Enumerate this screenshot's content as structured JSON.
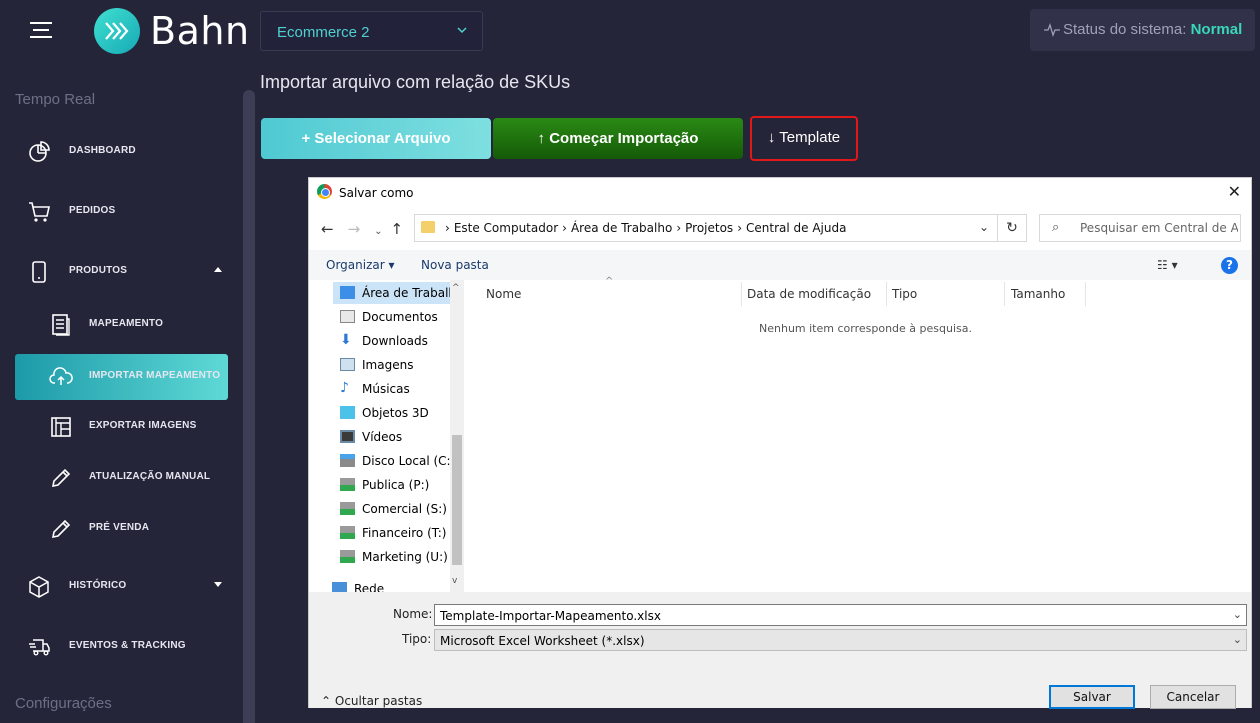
{
  "header": {
    "logo_text": "Bahn",
    "store_select": "Ecommerce 2",
    "status_label": "Status do sistema:",
    "status_value": "Normal"
  },
  "sidebar": {
    "section_realtime": "Tempo Real",
    "section_config": "Configurações",
    "items": [
      {
        "label": "DASHBOARD"
      },
      {
        "label": "PEDIDOS"
      },
      {
        "label": "PRODUTOS"
      },
      {
        "label": "MAPEAMENTO"
      },
      {
        "label": "IMPORTAR MAPEAMENTO"
      },
      {
        "label": "EXPORTAR IMAGENS"
      },
      {
        "label": "ATUALIZAÇÃO MANUAL"
      },
      {
        "label": "PRÉ VENDA"
      },
      {
        "label": "HISTÓRICO"
      },
      {
        "label": "EVENTOS & TRACKING"
      }
    ]
  },
  "main": {
    "title": "Importar arquivo com relação de SKUs",
    "btn_select": "+ Selecionar Arquivo",
    "btn_start": "↑ Começar Importação",
    "btn_template": "↓ Template"
  },
  "dialog": {
    "title": "Salvar como",
    "breadcrumb": [
      "Este Computador",
      "Área de Trabalho",
      "Projetos",
      "Central de Ajuda"
    ],
    "search_placeholder": "Pesquisar em Central de Aju...",
    "organize": "Organizar ▾",
    "new_folder": "Nova pasta",
    "tree": [
      "Área de Trabalho",
      "Documentos",
      "Downloads",
      "Imagens",
      "Músicas",
      "Objetos 3D",
      "Vídeos",
      "Disco Local (C:)",
      "Publica (P:)",
      "Comercial (S:)",
      "Financeiro (T:)",
      "Marketing (U:)",
      "Rede"
    ],
    "columns": [
      "Nome",
      "Data de modificação",
      "Tipo",
      "Tamanho"
    ],
    "empty_message": "Nenhum item corresponde à pesquisa.",
    "name_label": "Nome:",
    "name_value": "Template-Importar-Mapeamento.xlsx",
    "type_label": "Tipo:",
    "type_value": "Microsoft Excel Worksheet (*.xlsx)",
    "hide_folders": "Ocultar pastas",
    "save_button": "Salvar",
    "cancel_button": "Cancelar"
  },
  "colors": {
    "accent": "#4fd1d0",
    "status_ok": "#39d7b8",
    "start_button": "#1f7a0e",
    "highlight_border": "#e01818"
  }
}
